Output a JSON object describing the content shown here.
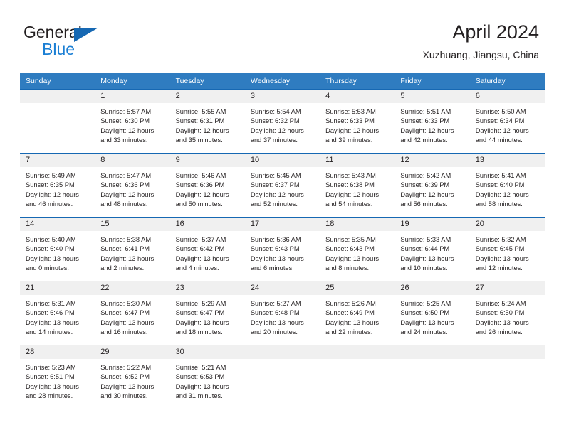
{
  "brand": {
    "line1": "General",
    "line2": "Blue",
    "triangle_color": "#1668b3",
    "blue_text_color": "#1b7fd4"
  },
  "header": {
    "title": "April 2024",
    "subtitle": "Xuzhuang, Jiangsu, China"
  },
  "theme": {
    "header_bg": "#2f7cc0",
    "row_divider": "#1668b3",
    "daynum_bg": "#f0f0f0",
    "text": "#231f20"
  },
  "weekdays": [
    "Sunday",
    "Monday",
    "Tuesday",
    "Wednesday",
    "Thursday",
    "Friday",
    "Saturday"
  ],
  "weeks": [
    [
      {
        "day": "",
        "sunrise": "",
        "sunset": "",
        "daylight1": "",
        "daylight2": "",
        "blank": true
      },
      {
        "day": "1",
        "sunrise": "Sunrise: 5:57 AM",
        "sunset": "Sunset: 6:30 PM",
        "daylight1": "Daylight: 12 hours",
        "daylight2": "and 33 minutes."
      },
      {
        "day": "2",
        "sunrise": "Sunrise: 5:55 AM",
        "sunset": "Sunset: 6:31 PM",
        "daylight1": "Daylight: 12 hours",
        "daylight2": "and 35 minutes."
      },
      {
        "day": "3",
        "sunrise": "Sunrise: 5:54 AM",
        "sunset": "Sunset: 6:32 PM",
        "daylight1": "Daylight: 12 hours",
        "daylight2": "and 37 minutes."
      },
      {
        "day": "4",
        "sunrise": "Sunrise: 5:53 AM",
        "sunset": "Sunset: 6:33 PM",
        "daylight1": "Daylight: 12 hours",
        "daylight2": "and 39 minutes."
      },
      {
        "day": "5",
        "sunrise": "Sunrise: 5:51 AM",
        "sunset": "Sunset: 6:33 PM",
        "daylight1": "Daylight: 12 hours",
        "daylight2": "and 42 minutes."
      },
      {
        "day": "6",
        "sunrise": "Sunrise: 5:50 AM",
        "sunset": "Sunset: 6:34 PM",
        "daylight1": "Daylight: 12 hours",
        "daylight2": "and 44 minutes."
      }
    ],
    [
      {
        "day": "7",
        "sunrise": "Sunrise: 5:49 AM",
        "sunset": "Sunset: 6:35 PM",
        "daylight1": "Daylight: 12 hours",
        "daylight2": "and 46 minutes."
      },
      {
        "day": "8",
        "sunrise": "Sunrise: 5:47 AM",
        "sunset": "Sunset: 6:36 PM",
        "daylight1": "Daylight: 12 hours",
        "daylight2": "and 48 minutes."
      },
      {
        "day": "9",
        "sunrise": "Sunrise: 5:46 AM",
        "sunset": "Sunset: 6:36 PM",
        "daylight1": "Daylight: 12 hours",
        "daylight2": "and 50 minutes."
      },
      {
        "day": "10",
        "sunrise": "Sunrise: 5:45 AM",
        "sunset": "Sunset: 6:37 PM",
        "daylight1": "Daylight: 12 hours",
        "daylight2": "and 52 minutes."
      },
      {
        "day": "11",
        "sunrise": "Sunrise: 5:43 AM",
        "sunset": "Sunset: 6:38 PM",
        "daylight1": "Daylight: 12 hours",
        "daylight2": "and 54 minutes."
      },
      {
        "day": "12",
        "sunrise": "Sunrise: 5:42 AM",
        "sunset": "Sunset: 6:39 PM",
        "daylight1": "Daylight: 12 hours",
        "daylight2": "and 56 minutes."
      },
      {
        "day": "13",
        "sunrise": "Sunrise: 5:41 AM",
        "sunset": "Sunset: 6:40 PM",
        "daylight1": "Daylight: 12 hours",
        "daylight2": "and 58 minutes."
      }
    ],
    [
      {
        "day": "14",
        "sunrise": "Sunrise: 5:40 AM",
        "sunset": "Sunset: 6:40 PM",
        "daylight1": "Daylight: 13 hours",
        "daylight2": "and 0 minutes."
      },
      {
        "day": "15",
        "sunrise": "Sunrise: 5:38 AM",
        "sunset": "Sunset: 6:41 PM",
        "daylight1": "Daylight: 13 hours",
        "daylight2": "and 2 minutes."
      },
      {
        "day": "16",
        "sunrise": "Sunrise: 5:37 AM",
        "sunset": "Sunset: 6:42 PM",
        "daylight1": "Daylight: 13 hours",
        "daylight2": "and 4 minutes."
      },
      {
        "day": "17",
        "sunrise": "Sunrise: 5:36 AM",
        "sunset": "Sunset: 6:43 PM",
        "daylight1": "Daylight: 13 hours",
        "daylight2": "and 6 minutes."
      },
      {
        "day": "18",
        "sunrise": "Sunrise: 5:35 AM",
        "sunset": "Sunset: 6:43 PM",
        "daylight1": "Daylight: 13 hours",
        "daylight2": "and 8 minutes."
      },
      {
        "day": "19",
        "sunrise": "Sunrise: 5:33 AM",
        "sunset": "Sunset: 6:44 PM",
        "daylight1": "Daylight: 13 hours",
        "daylight2": "and 10 minutes."
      },
      {
        "day": "20",
        "sunrise": "Sunrise: 5:32 AM",
        "sunset": "Sunset: 6:45 PM",
        "daylight1": "Daylight: 13 hours",
        "daylight2": "and 12 minutes."
      }
    ],
    [
      {
        "day": "21",
        "sunrise": "Sunrise: 5:31 AM",
        "sunset": "Sunset: 6:46 PM",
        "daylight1": "Daylight: 13 hours",
        "daylight2": "and 14 minutes."
      },
      {
        "day": "22",
        "sunrise": "Sunrise: 5:30 AM",
        "sunset": "Sunset: 6:47 PM",
        "daylight1": "Daylight: 13 hours",
        "daylight2": "and 16 minutes."
      },
      {
        "day": "23",
        "sunrise": "Sunrise: 5:29 AM",
        "sunset": "Sunset: 6:47 PM",
        "daylight1": "Daylight: 13 hours",
        "daylight2": "and 18 minutes."
      },
      {
        "day": "24",
        "sunrise": "Sunrise: 5:27 AM",
        "sunset": "Sunset: 6:48 PM",
        "daylight1": "Daylight: 13 hours",
        "daylight2": "and 20 minutes."
      },
      {
        "day": "25",
        "sunrise": "Sunrise: 5:26 AM",
        "sunset": "Sunset: 6:49 PM",
        "daylight1": "Daylight: 13 hours",
        "daylight2": "and 22 minutes."
      },
      {
        "day": "26",
        "sunrise": "Sunrise: 5:25 AM",
        "sunset": "Sunset: 6:50 PM",
        "daylight1": "Daylight: 13 hours",
        "daylight2": "and 24 minutes."
      },
      {
        "day": "27",
        "sunrise": "Sunrise: 5:24 AM",
        "sunset": "Sunset: 6:50 PM",
        "daylight1": "Daylight: 13 hours",
        "daylight2": "and 26 minutes."
      }
    ],
    [
      {
        "day": "28",
        "sunrise": "Sunrise: 5:23 AM",
        "sunset": "Sunset: 6:51 PM",
        "daylight1": "Daylight: 13 hours",
        "daylight2": "and 28 minutes."
      },
      {
        "day": "29",
        "sunrise": "Sunrise: 5:22 AM",
        "sunset": "Sunset: 6:52 PM",
        "daylight1": "Daylight: 13 hours",
        "daylight2": "and 30 minutes."
      },
      {
        "day": "30",
        "sunrise": "Sunrise: 5:21 AM",
        "sunset": "Sunset: 6:53 PM",
        "daylight1": "Daylight: 13 hours",
        "daylight2": "and 31 minutes."
      },
      {
        "day": "",
        "sunrise": "",
        "sunset": "",
        "daylight1": "",
        "daylight2": "",
        "blank": true
      },
      {
        "day": "",
        "sunrise": "",
        "sunset": "",
        "daylight1": "",
        "daylight2": "",
        "blank": true
      },
      {
        "day": "",
        "sunrise": "",
        "sunset": "",
        "daylight1": "",
        "daylight2": "",
        "blank": true
      },
      {
        "day": "",
        "sunrise": "",
        "sunset": "",
        "daylight1": "",
        "daylight2": "",
        "blank": true
      }
    ]
  ]
}
